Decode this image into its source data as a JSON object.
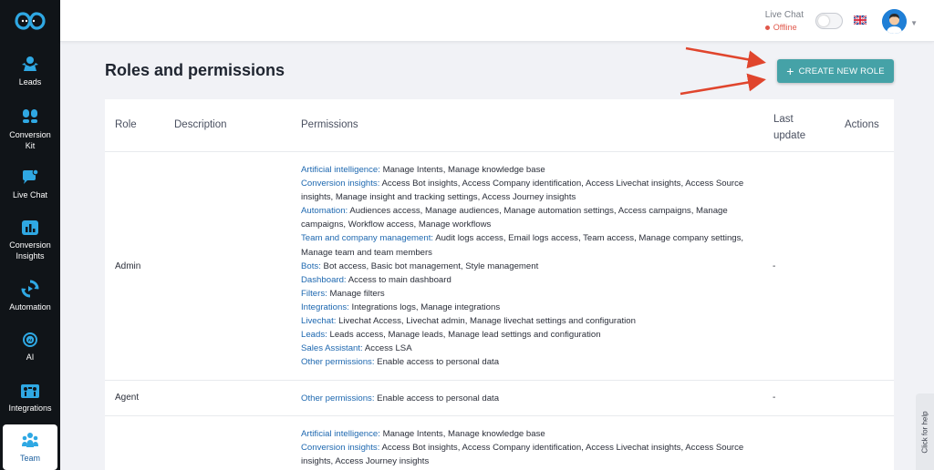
{
  "sidebar": {
    "items": [
      {
        "label": "Leads",
        "icon": "leads-icon"
      },
      {
        "label": "Conversion Kit",
        "icon": "conversion-kit-icon"
      },
      {
        "label": "Live Chat",
        "icon": "live-chat-icon"
      },
      {
        "label": "Conversion Insights",
        "icon": "conversion-insights-icon"
      },
      {
        "label": "Automation",
        "icon": "automation-icon"
      },
      {
        "label": "AI",
        "icon": "ai-icon"
      },
      {
        "label": "Integrations",
        "icon": "integrations-icon"
      },
      {
        "label": "Team",
        "icon": "team-icon",
        "active": true
      }
    ]
  },
  "header": {
    "livechat_label": "Live Chat",
    "livechat_status": "Offline",
    "language_flag": "uk-flag-icon"
  },
  "page": {
    "title": "Roles and permissions",
    "create_button": "CREATE NEW ROLE"
  },
  "table": {
    "columns": {
      "role": "Role",
      "description": "Description",
      "permissions": "Permissions",
      "last_update_1": "Last",
      "last_update_2": "update",
      "actions": "Actions"
    },
    "rows": [
      {
        "role": "Admin",
        "last_update": "-",
        "permissions": [
          {
            "category": "Artificial intelligence:",
            "text": " Manage Intents, Manage knowledge base"
          },
          {
            "category": "Conversion insights:",
            "text": " Access Bot insights, Access Company identification, Access Livechat insights, Access Source insights, Manage insight and tracking settings, Access Journey insights"
          },
          {
            "category": "Automation:",
            "text": " Audiences access, Manage audiences, Manage automation settings, Access campaigns, Manage campaigns, Workflow access, Manage workflows"
          },
          {
            "category": "Team and company management:",
            "text": " Audit logs access, Email logs access, Team access, Manage company settings, Manage team and team members"
          },
          {
            "category": "Bots:",
            "text": " Bot access, Basic bot management, Style management"
          },
          {
            "category": "Dashboard:",
            "text": " Access to main dashboard"
          },
          {
            "category": "Filters:",
            "text": " Manage filters"
          },
          {
            "category": "Integrations:",
            "text": " Integrations logs, Manage integrations"
          },
          {
            "category": "Livechat:",
            "text": " Livechat Access, Livechat admin, Manage livechat settings and configuration"
          },
          {
            "category": "Leads:",
            "text": " Leads access, Manage leads, Manage lead settings and configuration"
          },
          {
            "category": "Sales Assistant:",
            "text": " Access LSA"
          },
          {
            "category": "Other permissions:",
            "text": " Enable access to personal data"
          }
        ]
      },
      {
        "role": "Agent",
        "last_update": "-",
        "permissions": [
          {
            "category": "Other permissions:",
            "text": " Enable access to personal data"
          }
        ]
      },
      {
        "role": "",
        "last_update": "",
        "permissions": [
          {
            "category": "Artificial intelligence:",
            "text": " Manage Intents, Manage knowledge base"
          },
          {
            "category": "Conversion insights:",
            "text": " Access Bot insights, Access Company identification, Access Livechat insights, Access Source insights, Access Journey insights"
          }
        ]
      }
    ]
  },
  "help_tab": "Click for help",
  "colors": {
    "sidebar_bg": "#101418",
    "accent_button": "#45a2a7",
    "permission_category": "#1e68b0",
    "offline_status": "#e0574a",
    "annotation_arrow": "#e0452d"
  }
}
